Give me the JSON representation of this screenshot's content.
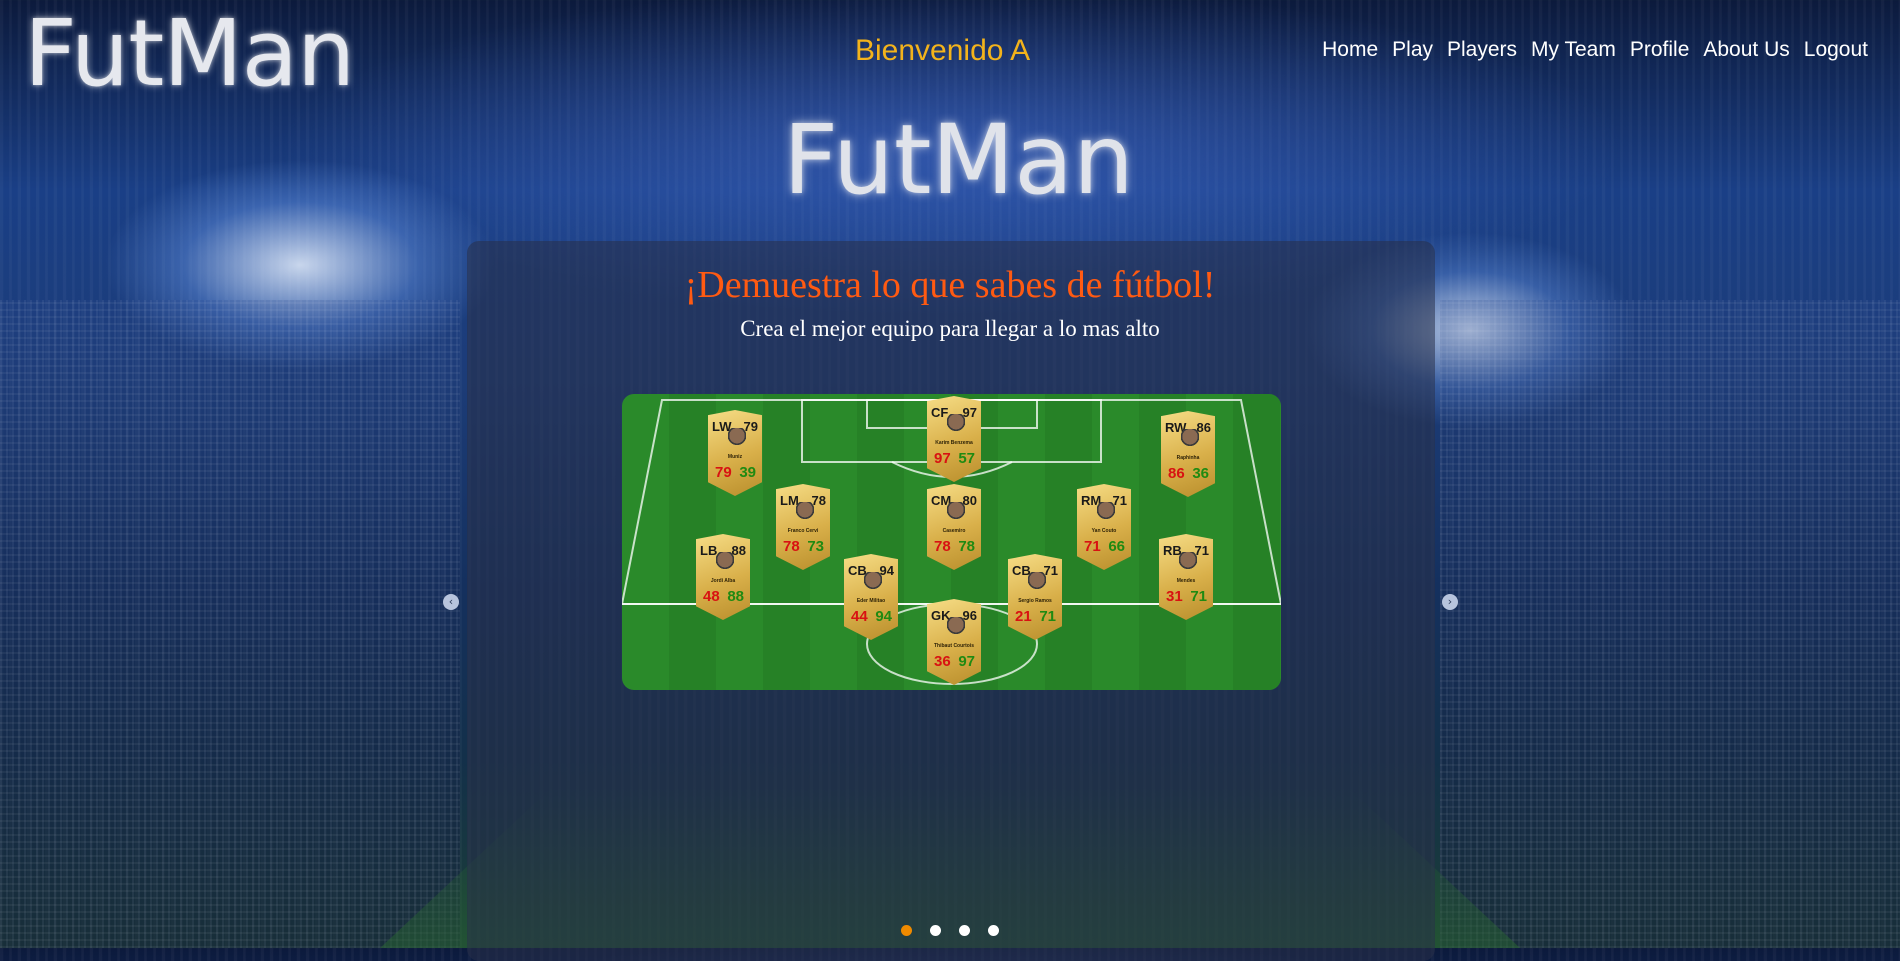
{
  "header": {
    "logo": "FutMan",
    "welcome": "Bienvenido A",
    "nav": [
      "Home",
      "Play",
      "Players",
      "My Team",
      "Profile",
      "About Us",
      "Logout"
    ]
  },
  "hero": {
    "logo": "FutMan",
    "slogan": "¡Demuestra lo que sabes de fútbol!",
    "subtitle": "Crea el mejor equipo para llegar a lo mas alto"
  },
  "carousel": {
    "prev_icon": "chevron-left-icon",
    "next_icon": "chevron-right-icon",
    "slides": 4,
    "active_slide": 1
  },
  "lineup": [
    {
      "pos": "LW",
      "ovr": "79",
      "name": "Muniz",
      "s1": "79",
      "s2": "39"
    },
    {
      "pos": "CF",
      "ovr": "97",
      "name": "Karim Benzema",
      "s1": "97",
      "s2": "57"
    },
    {
      "pos": "RW",
      "ovr": "86",
      "name": "Raphinha",
      "s1": "86",
      "s2": "36"
    },
    {
      "pos": "LM",
      "ovr": "78",
      "name": "Franco Cervi",
      "s1": "78",
      "s2": "73"
    },
    {
      "pos": "CM",
      "ovr": "80",
      "name": "Casemiro",
      "s1": "78",
      "s2": "78"
    },
    {
      "pos": "RM",
      "ovr": "71",
      "name": "Yan Couto",
      "s1": "71",
      "s2": "66"
    },
    {
      "pos": "LB",
      "ovr": "88",
      "name": "Jordi Alba",
      "s1": "48",
      "s2": "88"
    },
    {
      "pos": "CB",
      "ovr": "94",
      "name": "Eder Militao",
      "s1": "44",
      "s2": "94"
    },
    {
      "pos": "CB",
      "ovr": "71",
      "name": "Sergio Ramos",
      "s1": "21",
      "s2": "71"
    },
    {
      "pos": "RB",
      "ovr": "71",
      "name": "Mendes",
      "s1": "31",
      "s2": "71"
    },
    {
      "pos": "GK",
      "ovr": "96",
      "name": "Thibaut Courtois",
      "s1": "36",
      "s2": "97"
    }
  ],
  "colors": {
    "welcome": "#f3b31b",
    "slogan": "#ff5a12",
    "dot_active": "#f08a00",
    "stat_attack": "#d81212",
    "stat_defense": "#1f8a12"
  }
}
